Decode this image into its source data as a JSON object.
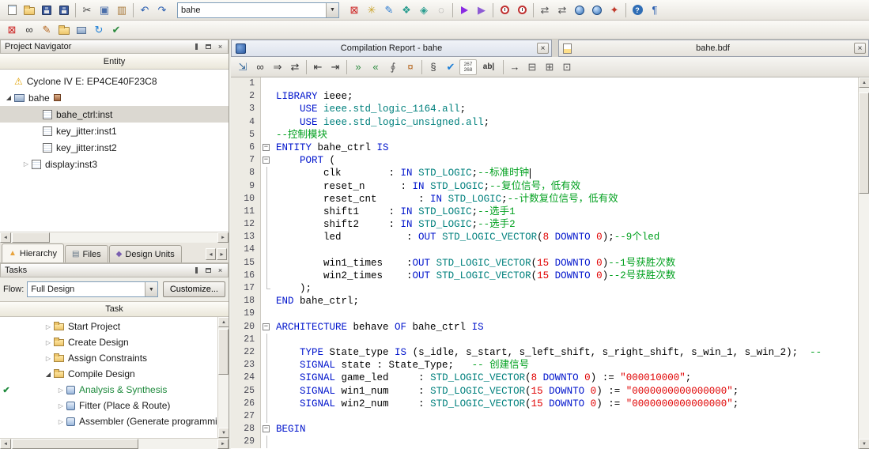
{
  "colors": {
    "keyword": "#0014cc",
    "type": "#00807d",
    "comment": "#00a01e",
    "number": "#e00000",
    "string": "#e00000",
    "plain": "#000000",
    "selection": "#dbd8d1"
  },
  "glyphs": {
    "check": "✔",
    "down": "◢",
    "right": "▷",
    "close": "×",
    "combo_arrow": "▼",
    "scroll_left": "◄",
    "scroll_right": "►",
    "scroll_up": "▲",
    "scroll_down": "▼",
    "tab_prev": "◂",
    "tab_next": "▸",
    "warning": "⚠",
    "fold_minus": "−"
  },
  "toolbar_main": {
    "combo_value": "bahe",
    "left_icons": [
      {
        "name": "new-file-icon",
        "shape": "doc"
      },
      {
        "name": "open-folder-icon",
        "shape": "folder"
      },
      {
        "name": "save-icon",
        "shape": "disk"
      },
      {
        "name": "save-all-icon",
        "shape": "disk"
      },
      {
        "sep": true
      },
      {
        "name": "cut-icon",
        "glyph": "✂",
        "color": "#444444"
      },
      {
        "name": "copy-icon",
        "glyph": "▣",
        "color": "#4a6ea9"
      },
      {
        "name": "paste-icon",
        "glyph": "▥",
        "color": "#a8793a"
      },
      {
        "sep": true
      },
      {
        "name": "undo-icon",
        "glyph": "↶",
        "color": "#2b5fb0"
      },
      {
        "name": "redo-icon",
        "glyph": "↷",
        "color": "#2b5fb0"
      }
    ],
    "right_icons": [
      {
        "name": "assignment-editor-icon",
        "glyph": "⊠",
        "color": "#cc2222"
      },
      {
        "name": "pin-planner-icon",
        "glyph": "✳",
        "color": "#c9a227"
      },
      {
        "name": "chip-planner-icon",
        "glyph": "✎",
        "color": "#2d7dd2"
      },
      {
        "name": "design-partition-icon",
        "glyph": "❖",
        "color": "#2a9d8f"
      },
      {
        "name": "netlist-viewer-icon",
        "glyph": "◈",
        "color": "#2a9d8f"
      },
      {
        "name": "cd-icon",
        "glyph": "◌",
        "color": "#888888"
      },
      {
        "sep": true
      },
      {
        "name": "start-compilation-icon",
        "shape": "play"
      },
      {
        "name": "start-analysis-icon",
        "glyph": "▶",
        "color": "#8d5bd4"
      },
      {
        "sep": true
      },
      {
        "name": "timequest-icon",
        "shape": "clock"
      },
      {
        "name": "timing-analyzer-icon",
        "shape": "clock"
      },
      {
        "sep": true
      },
      {
        "name": "rtl-viewer-icon",
        "glyph": "⇄",
        "color": "#555555"
      },
      {
        "name": "tech-map-viewer-icon",
        "glyph": "⇄",
        "color": "#555555"
      },
      {
        "name": "programmer-icon",
        "shape": "globe"
      },
      {
        "name": "convert-data-icon",
        "shape": "globe"
      },
      {
        "name": "resource-icon",
        "glyph": "✦",
        "color": "#c0392b"
      },
      {
        "sep": true
      },
      {
        "name": "help-icon",
        "shape": "help"
      },
      {
        "name": "context-help-icon",
        "glyph": "¶",
        "color": "#2b5fb0"
      }
    ]
  },
  "toolbar_secondary": {
    "icons": [
      {
        "name": "stop-process-icon",
        "glyph": "⊠",
        "color": "#cc2222"
      },
      {
        "name": "find-icon",
        "glyph": "∞",
        "color": "#333333"
      },
      {
        "name": "edit-icon",
        "glyph": "✎",
        "color": "#b5651d"
      },
      {
        "name": "archive-icon",
        "shape": "folder"
      },
      {
        "name": "component-icon",
        "shape": "chip"
      },
      {
        "name": "refresh-icon",
        "glyph": "↻",
        "color": "#1c7ed6"
      },
      {
        "name": "check-document-icon",
        "glyph": "✔",
        "color": "#2b8a3e"
      }
    ]
  },
  "project_navigator": {
    "title": "Project Navigator",
    "entity_header": "Entity",
    "tree": [
      {
        "label": "Cyclone IV E: EP4CE40F23C8",
        "depth": 0,
        "icon": "warning"
      },
      {
        "label": "bahe",
        "depth": 0,
        "arrow": "down",
        "icon": "chip",
        "badge": true
      },
      {
        "label": "bahe_ctrl:inst",
        "depth": 1,
        "icon": "inst",
        "selected": true
      },
      {
        "label": "key_jitter:inst1",
        "depth": 1,
        "icon": "inst"
      },
      {
        "label": "key_jitter:inst2",
        "depth": 1,
        "icon": "inst"
      },
      {
        "label": "display:inst3",
        "depth": 1,
        "arrow": "right",
        "icon": "inst"
      }
    ],
    "tabs": [
      {
        "label": "Hierarchy",
        "glyph": "▲",
        "color": "#e8a33d",
        "active": true
      },
      {
        "label": "Files",
        "glyph": "▤",
        "color": "#667788"
      },
      {
        "label": "Design Units",
        "glyph": "◆",
        "color": "#7a5fb0"
      }
    ]
  },
  "tasks": {
    "title": "Tasks",
    "flow_label": "Flow:",
    "flow_value": "Full Design",
    "customize_label": "Customize...",
    "column_header": "Task",
    "rows": [
      {
        "label": "Start Project",
        "depth": 1,
        "arrow": "right",
        "icon": "folder"
      },
      {
        "label": "Create Design",
        "depth": 1,
        "arrow": "right",
        "icon": "folder"
      },
      {
        "label": "Assign Constraints",
        "depth": 1,
        "arrow": "right",
        "icon": "folder"
      },
      {
        "label": "Compile Design",
        "depth": 1,
        "arrow": "down",
        "icon": "folder"
      },
      {
        "label": "Analysis & Synthesis",
        "depth": 2,
        "arrow": "right",
        "icon": "task",
        "check": true,
        "highlight": "#1f8a3d"
      },
      {
        "label": "Fitter (Place & Route)",
        "depth": 2,
        "arrow": "right",
        "icon": "task"
      },
      {
        "label": "Assembler (Generate programming",
        "depth": 2,
        "arrow": "right",
        "icon": "task"
      }
    ]
  },
  "document_tabs": [
    {
      "title": "Compilation Report - bahe",
      "icon": "report"
    },
    {
      "title": "bahe.bdf",
      "icon": "bdf"
    }
  ],
  "editor": {
    "line_counter": {
      "top": "267",
      "bottom": "268"
    },
    "toolbar_icons": [
      {
        "name": "export-icon",
        "glyph": "⇲",
        "color": "#336699"
      },
      {
        "name": "find-icon",
        "glyph": "∞",
        "color": "#333333"
      },
      {
        "name": "find-next-icon",
        "glyph": "⇒",
        "color": "#333333"
      },
      {
        "name": "replace-icon",
        "glyph": "⇄",
        "color": "#333333"
      },
      {
        "sep": true
      },
      {
        "name": "outdent-icon",
        "glyph": "⇤",
        "color": "#333333"
      },
      {
        "name": "indent-icon",
        "glyph": "⇥",
        "color": "#333333"
      },
      {
        "sep": true
      },
      {
        "name": "comment-icon",
        "glyph": "»",
        "color": "#2b8a3e"
      },
      {
        "name": "uncomment-icon",
        "glyph": "«",
        "color": "#2b8a3e"
      },
      {
        "name": "attach-icon",
        "glyph": "∮",
        "color": "#555555"
      },
      {
        "name": "bookmark-icon",
        "glyph": "¤",
        "color": "#b5651d"
      },
      {
        "sep": true
      },
      {
        "name": "template-icon",
        "glyph": "§",
        "color": "#444444"
      },
      {
        "name": "syntax-check-icon",
        "glyph": "✔",
        "color": "#1c7ed6"
      },
      {
        "name": "line-numbers-icon",
        "counter": true
      },
      {
        "name": "word-wrap-icon",
        "glyph": "ab|",
        "color": "#333333",
        "wide": true
      },
      {
        "sep": true
      },
      {
        "name": "goto-line-icon",
        "glyph": "→",
        "color": "#333333"
      },
      {
        "name": "split-window-icon",
        "glyph": "⊟",
        "color": "#555555"
      },
      {
        "name": "new-window-icon",
        "glyph": "⊞",
        "color": "#555555"
      },
      {
        "name": "detach-window-icon",
        "glyph": "⊡",
        "color": "#555555"
      }
    ],
    "lines": [
      {
        "n": 1,
        "t": []
      },
      {
        "n": 2,
        "t": [
          [
            "kw",
            "LIBRARY"
          ],
          [
            "pl",
            " ieee;"
          ]
        ]
      },
      {
        "n": 3,
        "t": [
          [
            "pl",
            "    "
          ],
          [
            "kw",
            "USE"
          ],
          [
            "pl",
            " "
          ],
          [
            "ty",
            "ieee.std_logic_1164.all"
          ],
          [
            "pl",
            ";"
          ]
        ]
      },
      {
        "n": 4,
        "t": [
          [
            "pl",
            "    "
          ],
          [
            "kw",
            "USE"
          ],
          [
            "pl",
            " "
          ],
          [
            "ty",
            "ieee.std_logic_unsigned.all"
          ],
          [
            "pl",
            ";"
          ]
        ]
      },
      {
        "n": 5,
        "t": [
          [
            "cm",
            "--控制模块"
          ]
        ]
      },
      {
        "n": 6,
        "fold": "box",
        "t": [
          [
            "kw",
            "ENTITY"
          ],
          [
            "pl",
            " bahe_ctrl "
          ],
          [
            "kw",
            "IS"
          ]
        ]
      },
      {
        "n": 7,
        "fold": "box",
        "t": [
          [
            "pl",
            "    "
          ],
          [
            "kw",
            "PORT"
          ],
          [
            "pl",
            " ("
          ]
        ]
      },
      {
        "n": 8,
        "fold": "line",
        "t": [
          [
            "pl",
            "        clk        : "
          ],
          [
            "kw",
            "IN"
          ],
          [
            "pl",
            " "
          ],
          [
            "ty",
            "STD_LOGIC"
          ],
          [
            "pl",
            ";"
          ],
          [
            "cm",
            "--标准时钟"
          ],
          [
            "caret",
            ""
          ]
        ]
      },
      {
        "n": 9,
        "fold": "line",
        "t": [
          [
            "pl",
            "        reset_n      : "
          ],
          [
            "kw",
            "IN"
          ],
          [
            "pl",
            " "
          ],
          [
            "ty",
            "STD_LOGIC"
          ],
          [
            "pl",
            ";"
          ],
          [
            "cm",
            "--复位信号，低有效"
          ]
        ]
      },
      {
        "n": 10,
        "fold": "line",
        "t": [
          [
            "pl",
            "        reset_cnt       : "
          ],
          [
            "kw",
            "IN"
          ],
          [
            "pl",
            " "
          ],
          [
            "ty",
            "STD_LOGIC"
          ],
          [
            "pl",
            ";"
          ],
          [
            "cm",
            "--计数复位信号，低有效"
          ]
        ]
      },
      {
        "n": 11,
        "fold": "line",
        "t": [
          [
            "pl",
            "        shift1     : "
          ],
          [
            "kw",
            "IN"
          ],
          [
            "pl",
            " "
          ],
          [
            "ty",
            "STD_LOGIC"
          ],
          [
            "pl",
            ";"
          ],
          [
            "cm",
            "--选手1"
          ]
        ]
      },
      {
        "n": 12,
        "fold": "line",
        "t": [
          [
            "pl",
            "        shift2     : "
          ],
          [
            "kw",
            "IN"
          ],
          [
            "pl",
            " "
          ],
          [
            "ty",
            "STD_LOGIC"
          ],
          [
            "pl",
            ";"
          ],
          [
            "cm",
            "--选手2"
          ]
        ]
      },
      {
        "n": 13,
        "fold": "line",
        "t": [
          [
            "pl",
            "        led           : "
          ],
          [
            "kw",
            "OUT"
          ],
          [
            "pl",
            " "
          ],
          [
            "ty",
            "STD_LOGIC_VECTOR"
          ],
          [
            "pl",
            "("
          ],
          [
            "nu",
            "8"
          ],
          [
            "pl",
            " "
          ],
          [
            "kw",
            "DOWNTO"
          ],
          [
            "pl",
            " "
          ],
          [
            "nu",
            "0"
          ],
          [
            "pl",
            ");"
          ],
          [
            "cm",
            "--9个led"
          ]
        ]
      },
      {
        "n": 14,
        "fold": "line",
        "t": []
      },
      {
        "n": 15,
        "fold": "line",
        "t": [
          [
            "pl",
            "        win1_times    :"
          ],
          [
            "kw",
            "OUT"
          ],
          [
            "pl",
            " "
          ],
          [
            "ty",
            "STD_LOGIC_VECTOR"
          ],
          [
            "pl",
            "("
          ],
          [
            "nu",
            "15"
          ],
          [
            "pl",
            " "
          ],
          [
            "kw",
            "DOWNTO"
          ],
          [
            "pl",
            " "
          ],
          [
            "nu",
            "0"
          ],
          [
            "pl",
            ")"
          ],
          [
            "cm",
            "--1号获胜次数"
          ]
        ]
      },
      {
        "n": 16,
        "fold": "line",
        "t": [
          [
            "pl",
            "        win2_times    :"
          ],
          [
            "kw",
            "OUT"
          ],
          [
            "pl",
            " "
          ],
          [
            "ty",
            "STD_LOGIC_VECTOR"
          ],
          [
            "pl",
            "("
          ],
          [
            "nu",
            "15"
          ],
          [
            "pl",
            " "
          ],
          [
            "kw",
            "DOWNTO"
          ],
          [
            "pl",
            " "
          ],
          [
            "nu",
            "0"
          ],
          [
            "pl",
            ")"
          ],
          [
            "cm",
            "--2号获胜次数"
          ]
        ]
      },
      {
        "n": 17,
        "fold": "end",
        "t": [
          [
            "pl",
            "    );"
          ]
        ]
      },
      {
        "n": 18,
        "t": [
          [
            "kw",
            "END"
          ],
          [
            "pl",
            " bahe_ctrl;"
          ]
        ]
      },
      {
        "n": 19,
        "t": []
      },
      {
        "n": 20,
        "fold": "box",
        "t": [
          [
            "kw",
            "ARCHITECTURE"
          ],
          [
            "pl",
            " behave "
          ],
          [
            "kw",
            "OF"
          ],
          [
            "pl",
            " bahe_ctrl "
          ],
          [
            "kw",
            "IS"
          ]
        ]
      },
      {
        "n": 21,
        "fold": "line",
        "t": []
      },
      {
        "n": 22,
        "fold": "line",
        "t": [
          [
            "pl",
            "    "
          ],
          [
            "kw",
            "TYPE"
          ],
          [
            "pl",
            " State_type "
          ],
          [
            "kw",
            "IS"
          ],
          [
            "pl",
            " (s_idle, s_start, s_left_shift, s_right_shift, s_win_1, s_win_2);  "
          ],
          [
            "cm",
            "--"
          ]
        ]
      },
      {
        "n": 23,
        "fold": "line",
        "t": [
          [
            "pl",
            "    "
          ],
          [
            "kw",
            "SIGNAL"
          ],
          [
            "pl",
            " state : State_Type;   "
          ],
          [
            "cm",
            "-- 创建信号"
          ]
        ]
      },
      {
        "n": 24,
        "fold": "line",
        "t": [
          [
            "pl",
            "    "
          ],
          [
            "kw",
            "SIGNAL"
          ],
          [
            "pl",
            " game_led     : "
          ],
          [
            "ty",
            "STD_LOGIC_VECTOR"
          ],
          [
            "pl",
            "("
          ],
          [
            "nu",
            "8"
          ],
          [
            "pl",
            " "
          ],
          [
            "kw",
            "DOWNTO"
          ],
          [
            "pl",
            " "
          ],
          [
            "nu",
            "0"
          ],
          [
            "pl",
            ") := "
          ],
          [
            "st",
            "\"000010000\""
          ],
          [
            "pl",
            ";"
          ]
        ]
      },
      {
        "n": 25,
        "fold": "line",
        "t": [
          [
            "pl",
            "    "
          ],
          [
            "kw",
            "SIGNAL"
          ],
          [
            "pl",
            " win1_num     : "
          ],
          [
            "ty",
            "STD_LOGIC_VECTOR"
          ],
          [
            "pl",
            "("
          ],
          [
            "nu",
            "15"
          ],
          [
            "pl",
            " "
          ],
          [
            "kw",
            "DOWNTO"
          ],
          [
            "pl",
            " "
          ],
          [
            "nu",
            "0"
          ],
          [
            "pl",
            ") := "
          ],
          [
            "st",
            "\"0000000000000000\""
          ],
          [
            "pl",
            ";"
          ]
        ]
      },
      {
        "n": 26,
        "fold": "line",
        "t": [
          [
            "pl",
            "    "
          ],
          [
            "kw",
            "SIGNAL"
          ],
          [
            "pl",
            " win2_num     : "
          ],
          [
            "ty",
            "STD_LOGIC_VECTOR"
          ],
          [
            "pl",
            "("
          ],
          [
            "nu",
            "15"
          ],
          [
            "pl",
            " "
          ],
          [
            "kw",
            "DOWNTO"
          ],
          [
            "pl",
            " "
          ],
          [
            "nu",
            "0"
          ],
          [
            "pl",
            ") := "
          ],
          [
            "st",
            "\"0000000000000000\""
          ],
          [
            "pl",
            ";"
          ]
        ]
      },
      {
        "n": 27,
        "fold": "line",
        "t": []
      },
      {
        "n": 28,
        "fold": "box",
        "t": [
          [
            "kw",
            "BEGIN"
          ]
        ]
      },
      {
        "n": 29,
        "fold": "line",
        "t": []
      }
    ]
  }
}
